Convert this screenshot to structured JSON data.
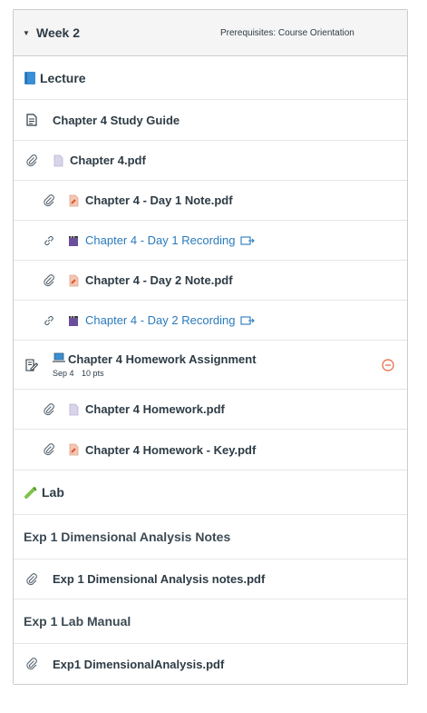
{
  "module": {
    "title": "Week 2",
    "prerequisites": "Prerequisites: Course Orientation"
  },
  "items": [
    {
      "kind": "header",
      "emoji": "blue-book",
      "label": "Lecture"
    },
    {
      "kind": "page",
      "icon": "document-icon",
      "label": "Chapter 4 Study Guide"
    },
    {
      "kind": "file",
      "icon": "paperclip-icon",
      "file_icon": "plain-file",
      "label": "Chapter 4.pdf"
    },
    {
      "kind": "file",
      "icon": "paperclip-icon",
      "file_icon": "pdf-file",
      "label": "Chapter 4 - Day 1 Note.pdf"
    },
    {
      "kind": "link",
      "icon": "link-icon",
      "file_icon": "clapper-file",
      "label": "Chapter 4 - Day 1 Recording"
    },
    {
      "kind": "file",
      "icon": "paperclip-icon",
      "file_icon": "pdf-file",
      "label": "Chapter 4 - Day 2 Note.pdf"
    },
    {
      "kind": "link",
      "icon": "link-icon",
      "file_icon": "clapper-file",
      "label": "Chapter 4 - Day 2 Recording"
    },
    {
      "kind": "assignment",
      "icon": "assignment-icon",
      "emoji": "laptop",
      "label": "Chapter 4 Homework Assignment",
      "due": "Sep 4",
      "points": "10 pts"
    },
    {
      "kind": "file",
      "icon": "paperclip-icon",
      "file_icon": "plain-file",
      "label": "Chapter 4 Homework.pdf"
    },
    {
      "kind": "file",
      "icon": "paperclip-icon",
      "file_icon": "pdf-file",
      "label": "Chapter 4 Homework - Key.pdf"
    },
    {
      "kind": "header",
      "emoji": "test-tube",
      "label": "Lab"
    },
    {
      "kind": "subheader",
      "label": "Exp 1 Dimensional Analysis Notes"
    },
    {
      "kind": "file",
      "icon": "paperclip-icon",
      "label": "Exp 1 Dimensional Analysis notes.pdf"
    },
    {
      "kind": "subheader",
      "label": "Exp 1 Lab Manual"
    },
    {
      "kind": "file",
      "icon": "paperclip-icon",
      "label": "Exp1 DimensionalAnalysis.pdf"
    }
  ],
  "colors": {
    "link": "#2b7abc",
    "text": "#2d3b45",
    "header_bg": "#f5f5f5",
    "unpublish": "#e66135"
  }
}
